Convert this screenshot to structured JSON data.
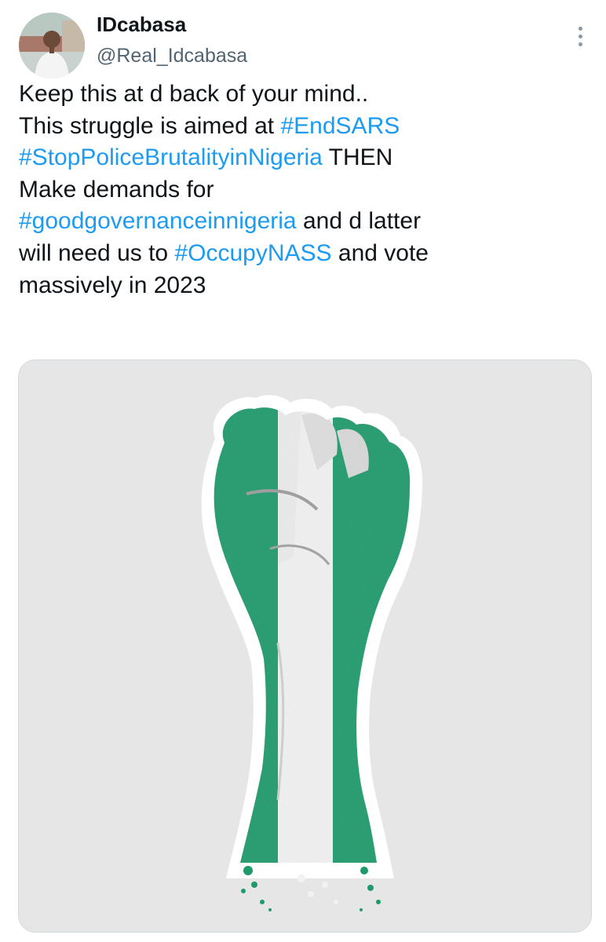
{
  "user": {
    "display_name": "IDcabasa",
    "handle": "@Real_Idcabasa"
  },
  "tweet": {
    "segments": [
      {
        "text": "Keep this at d back of your mind..\nThis struggle is aimed at ",
        "type": "text"
      },
      {
        "text": "#EndSARS",
        "type": "hashtag"
      },
      {
        "text": "\n",
        "type": "text"
      },
      {
        "text": "#StopPoliceBrutalityinNigeria",
        "type": "hashtag"
      },
      {
        "text": " THEN\nMake demands for\n",
        "type": "text"
      },
      {
        "text": "#goodgovernanceinnigeria",
        "type": "hashtag"
      },
      {
        "text": " and d latter\nwill need us to ",
        "type": "text"
      },
      {
        "text": "#OccupyNASS",
        "type": "hashtag"
      },
      {
        "text": " and vote\nmassively in 2023",
        "type": "text"
      }
    ]
  },
  "media": {
    "subject": "raised-fist-nigeria-flag",
    "flag_colors": {
      "green": "#1e9a6b",
      "white": "#f2f2f2"
    },
    "background": "#e6e6e6"
  },
  "icons": {
    "more": "more-vertical-icon"
  },
  "colors": {
    "hashtag": "#1d9bf0",
    "text": "#0f1419",
    "secondary": "#536471"
  }
}
